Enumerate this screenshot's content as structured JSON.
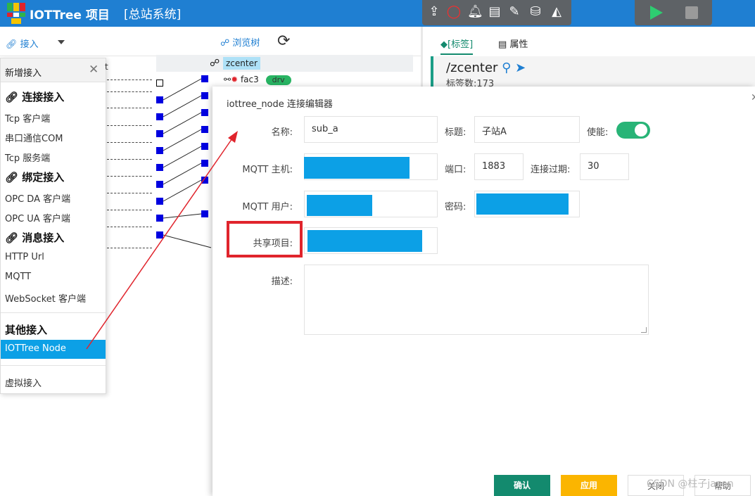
{
  "header": {
    "app_title": "IOTTree 项目",
    "project_title": "[总站系统]"
  },
  "toolbar": {
    "connect_label": "接入",
    "browse_tree_label": "浏览树"
  },
  "right_panel": {
    "tabs": [
      "[标签]",
      "属性"
    ],
    "path": "/zcenter",
    "tag_count": "标签数:173"
  },
  "tree": {
    "root": "zcenter",
    "child": "fac3",
    "child_badge": "drv"
  },
  "menu": {
    "title": "新增接入",
    "truncated_label": "t",
    "sections": {
      "connect": "连接接入",
      "bind": "绑定接入",
      "message": "消息接入",
      "other": "其他接入"
    },
    "connect_items": [
      "Tcp 客户端",
      "串口通信COM",
      "Tcp 服务端"
    ],
    "bind_items": [
      "OPC DA 客户端",
      "OPC UA 客户端"
    ],
    "message_items": [
      "HTTP Url",
      "MQTT",
      "WebSocket 客户端"
    ],
    "other_items": [
      "IOTTree Node"
    ],
    "virtual_item": "虚拟接入"
  },
  "dialog": {
    "title": "iottree_node 连接编辑器",
    "name_label": "名称:",
    "name_value": "sub_a",
    "caption_label": "标题:",
    "caption_value": "子站A",
    "enable_label": "使能:",
    "mqtt_host_label": "MQTT 主机:",
    "port_label": "端口:",
    "port_value": "1883",
    "timeout_label": "连接过期:",
    "timeout_value": "30",
    "mqtt_user_label": "MQTT 用户:",
    "password_label": "密码:",
    "shared_project_label": "共享项目:",
    "desc_label": "描述:",
    "buttons": {
      "ok": "确认",
      "apply": "应用",
      "close": "关闭",
      "help": "帮助"
    }
  },
  "watermark": "CSDN @柱子jason",
  "colors": {
    "header_bg": "#1f7fd2",
    "accent_green": "#138a6e",
    "mask_blue": "#0ca0e6",
    "highlight_red": "#e0242c",
    "apply_orange": "#fbb500"
  }
}
